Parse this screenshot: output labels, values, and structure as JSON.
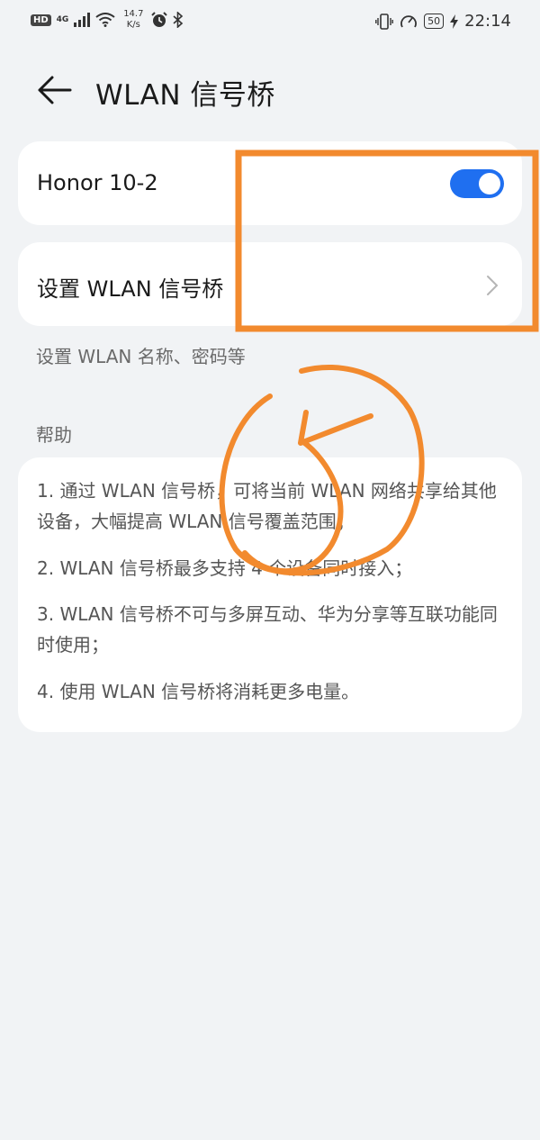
{
  "status_bar": {
    "hd": "HD",
    "network": "4G",
    "rate_value": "14.7",
    "rate_unit": "K/s",
    "battery": "50",
    "time": "22:14",
    "icons": [
      "signal-icon",
      "wifi-icon",
      "alarm-icon",
      "bluetooth-icon",
      "vibrate-icon",
      "data-saver-icon",
      "charging-icon"
    ]
  },
  "header": {
    "title": "WLAN 信号桥",
    "back_icon": "arrow-left-icon"
  },
  "toggle_row": {
    "label": "Honor 10-2",
    "enabled": true,
    "accent": "#1f6ff0"
  },
  "setup_row": {
    "label": "设置 WLAN 信号桥",
    "chevron_icon": "chevron-right-icon"
  },
  "setup_subtitle": "设置 WLAN 名称、密码等",
  "help": {
    "title": "帮助",
    "items": [
      "1. 通过 WLAN 信号桥，可将当前 WLAN 网络共享给其他设备，大幅提高 WLAN 信号覆盖范围；",
      "2. WLAN 信号桥最多支持 4 个设备同时接入；",
      "3. WLAN 信号桥不可与多屏互动、华为分享等互联功能同时使用；",
      "4. 使用 WLAN 信号桥将消耗更多电量。"
    ]
  },
  "annotations": {
    "color": "#f28a2e",
    "marks": [
      "rectangle-annotation",
      "handwritten-5-annotation"
    ]
  }
}
